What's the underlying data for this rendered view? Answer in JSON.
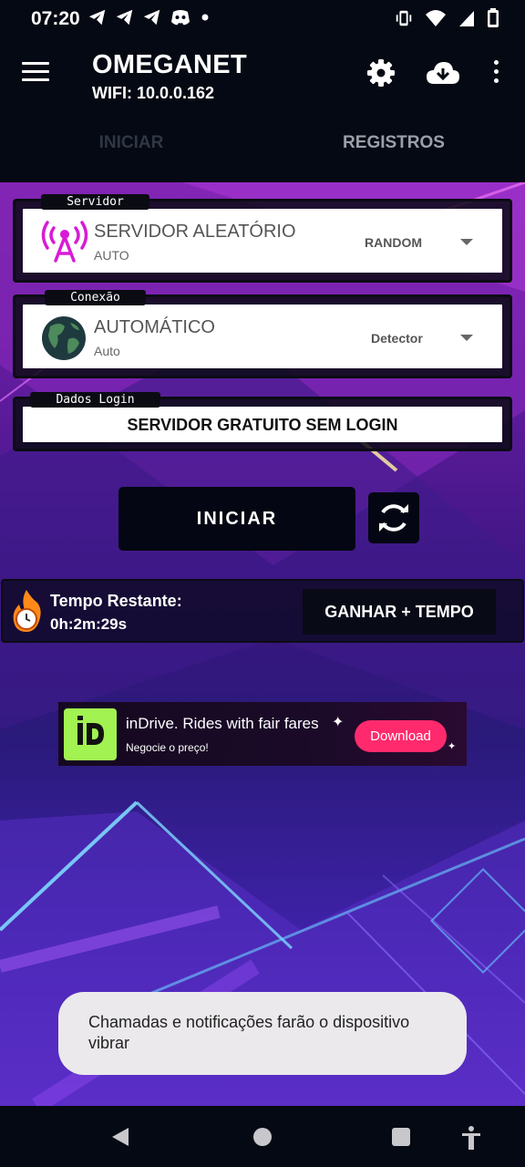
{
  "status_bar": {
    "time": "07:20",
    "left_icons": [
      "telegram-icon",
      "telegram-icon",
      "telegram-icon",
      "discord-icon",
      "dot-icon"
    ],
    "right_icons": [
      "vibrate-icon",
      "wifi-icon",
      "signal-icon",
      "battery-icon"
    ]
  },
  "app_bar": {
    "title": "OMEGANET",
    "subtitle": "WIFI: 10.0.0.162",
    "icons": [
      "menu-icon",
      "gear-icon",
      "cloud-download-icon",
      "more-vert-icon"
    ]
  },
  "tabs": [
    {
      "label": "INICIAR",
      "state": "selected"
    },
    {
      "label": "REGISTROS",
      "state": "unselected"
    }
  ],
  "server_card": {
    "label": "Servidor",
    "title": "SERVIDOR ALEATÓRIO",
    "subtitle": "AUTO",
    "tag": "RANDOM",
    "icon": "antenna-icon"
  },
  "connection_card": {
    "label": "Conexão",
    "title": "AUTOMÁTICO",
    "subtitle": "Auto",
    "tag": "Detector",
    "icon": "globe-icon"
  },
  "login_card": {
    "label": "Dados Login",
    "value": "SERVIDOR GRATUITO SEM LOGIN"
  },
  "actions": {
    "start_label": "INICIAR",
    "refresh_icon": "refresh-icon"
  },
  "timer": {
    "label": "Tempo Restante:",
    "value": "0h:2m:29s",
    "button_label": "GANHAR + TEMPO"
  },
  "ad": {
    "logo_text": "iD",
    "title": "inDrive. Rides with fair fares",
    "subtitle": "Negocie o preço!",
    "button_label": "Download"
  },
  "toast": {
    "message": "Chamadas e notificações farão o dispositivo vibrar"
  },
  "colors": {
    "background": "#050913",
    "accent_magenta": "#d81bd6",
    "ad_button": "#ff2a6d",
    "ad_logo": "#a2f252"
  }
}
